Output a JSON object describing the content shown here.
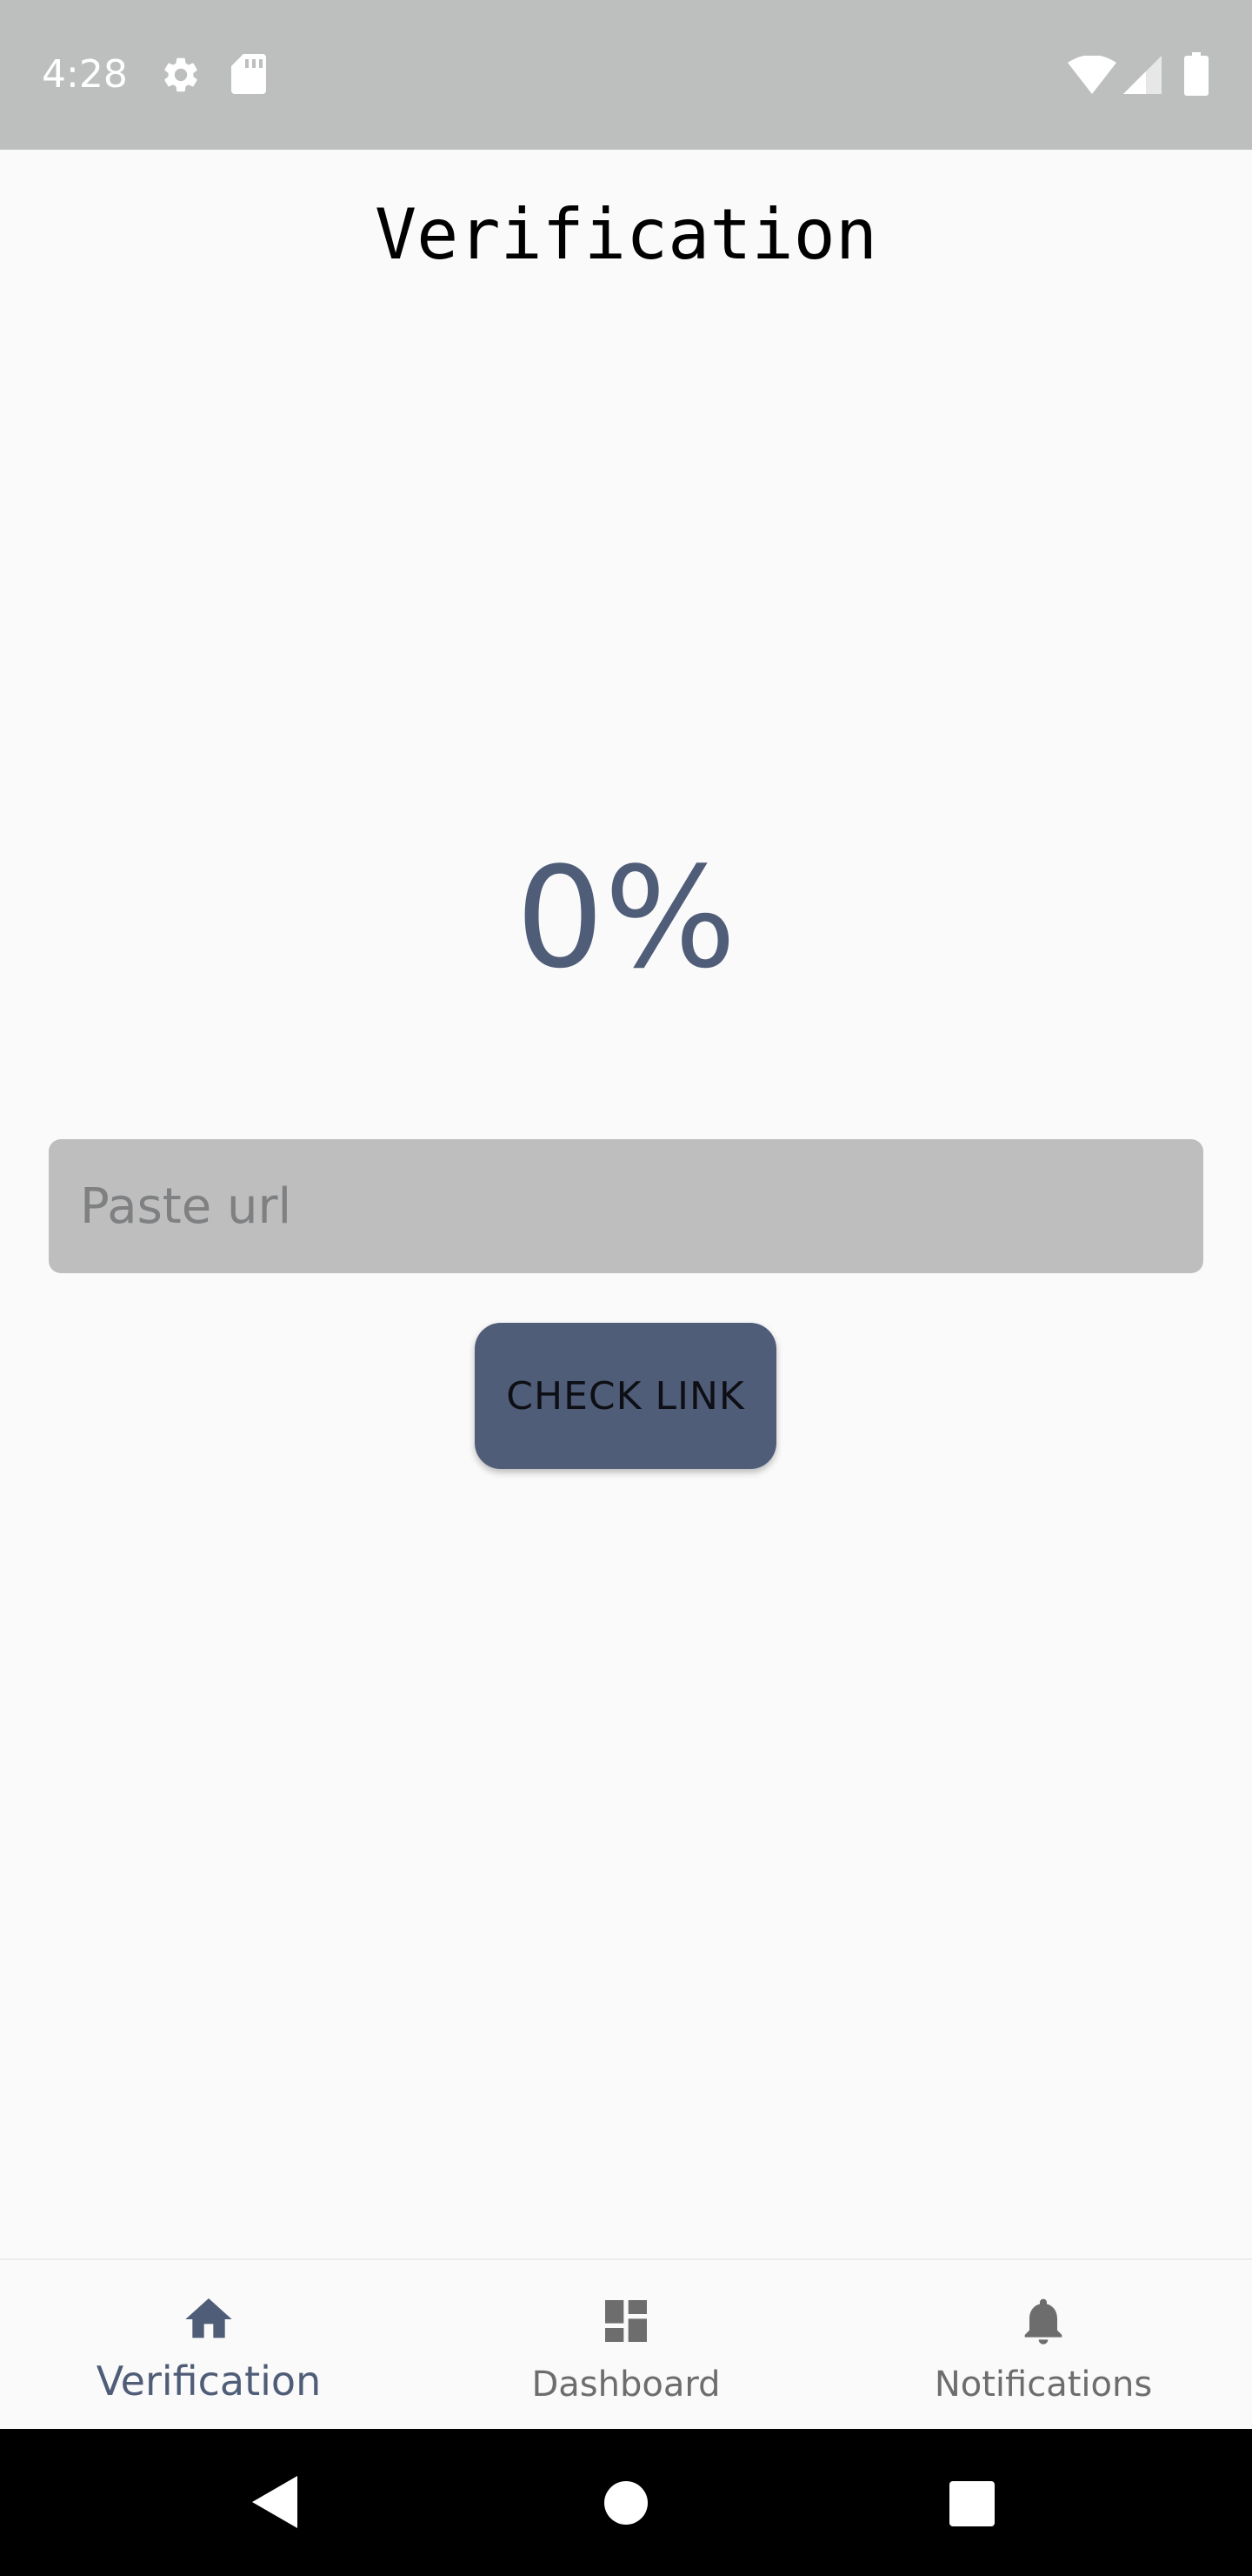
{
  "status_bar": {
    "time": "4:28",
    "icons": [
      "settings-icon",
      "sd-card-icon",
      "wifi-icon",
      "cellular-signal-icon",
      "battery-icon"
    ],
    "background": "#bdbfbe"
  },
  "header": {
    "title": "Verification"
  },
  "main": {
    "progress_text": "0%",
    "progress_value": 0,
    "url_input": {
      "placeholder": "Paste url",
      "value": ""
    },
    "check_button_label": "CHECK LINK",
    "accent_color": "#505d78"
  },
  "bottom_nav": {
    "items": [
      {
        "label": "Verification",
        "icon": "home-icon",
        "active": true
      },
      {
        "label": "Dashboard",
        "icon": "dashboard-icon",
        "active": false
      },
      {
        "label": "Notifications",
        "icon": "bell-icon",
        "active": false
      }
    ]
  },
  "system_nav": {
    "buttons": [
      "back-icon",
      "home-circle-icon",
      "recents-icon"
    ]
  }
}
